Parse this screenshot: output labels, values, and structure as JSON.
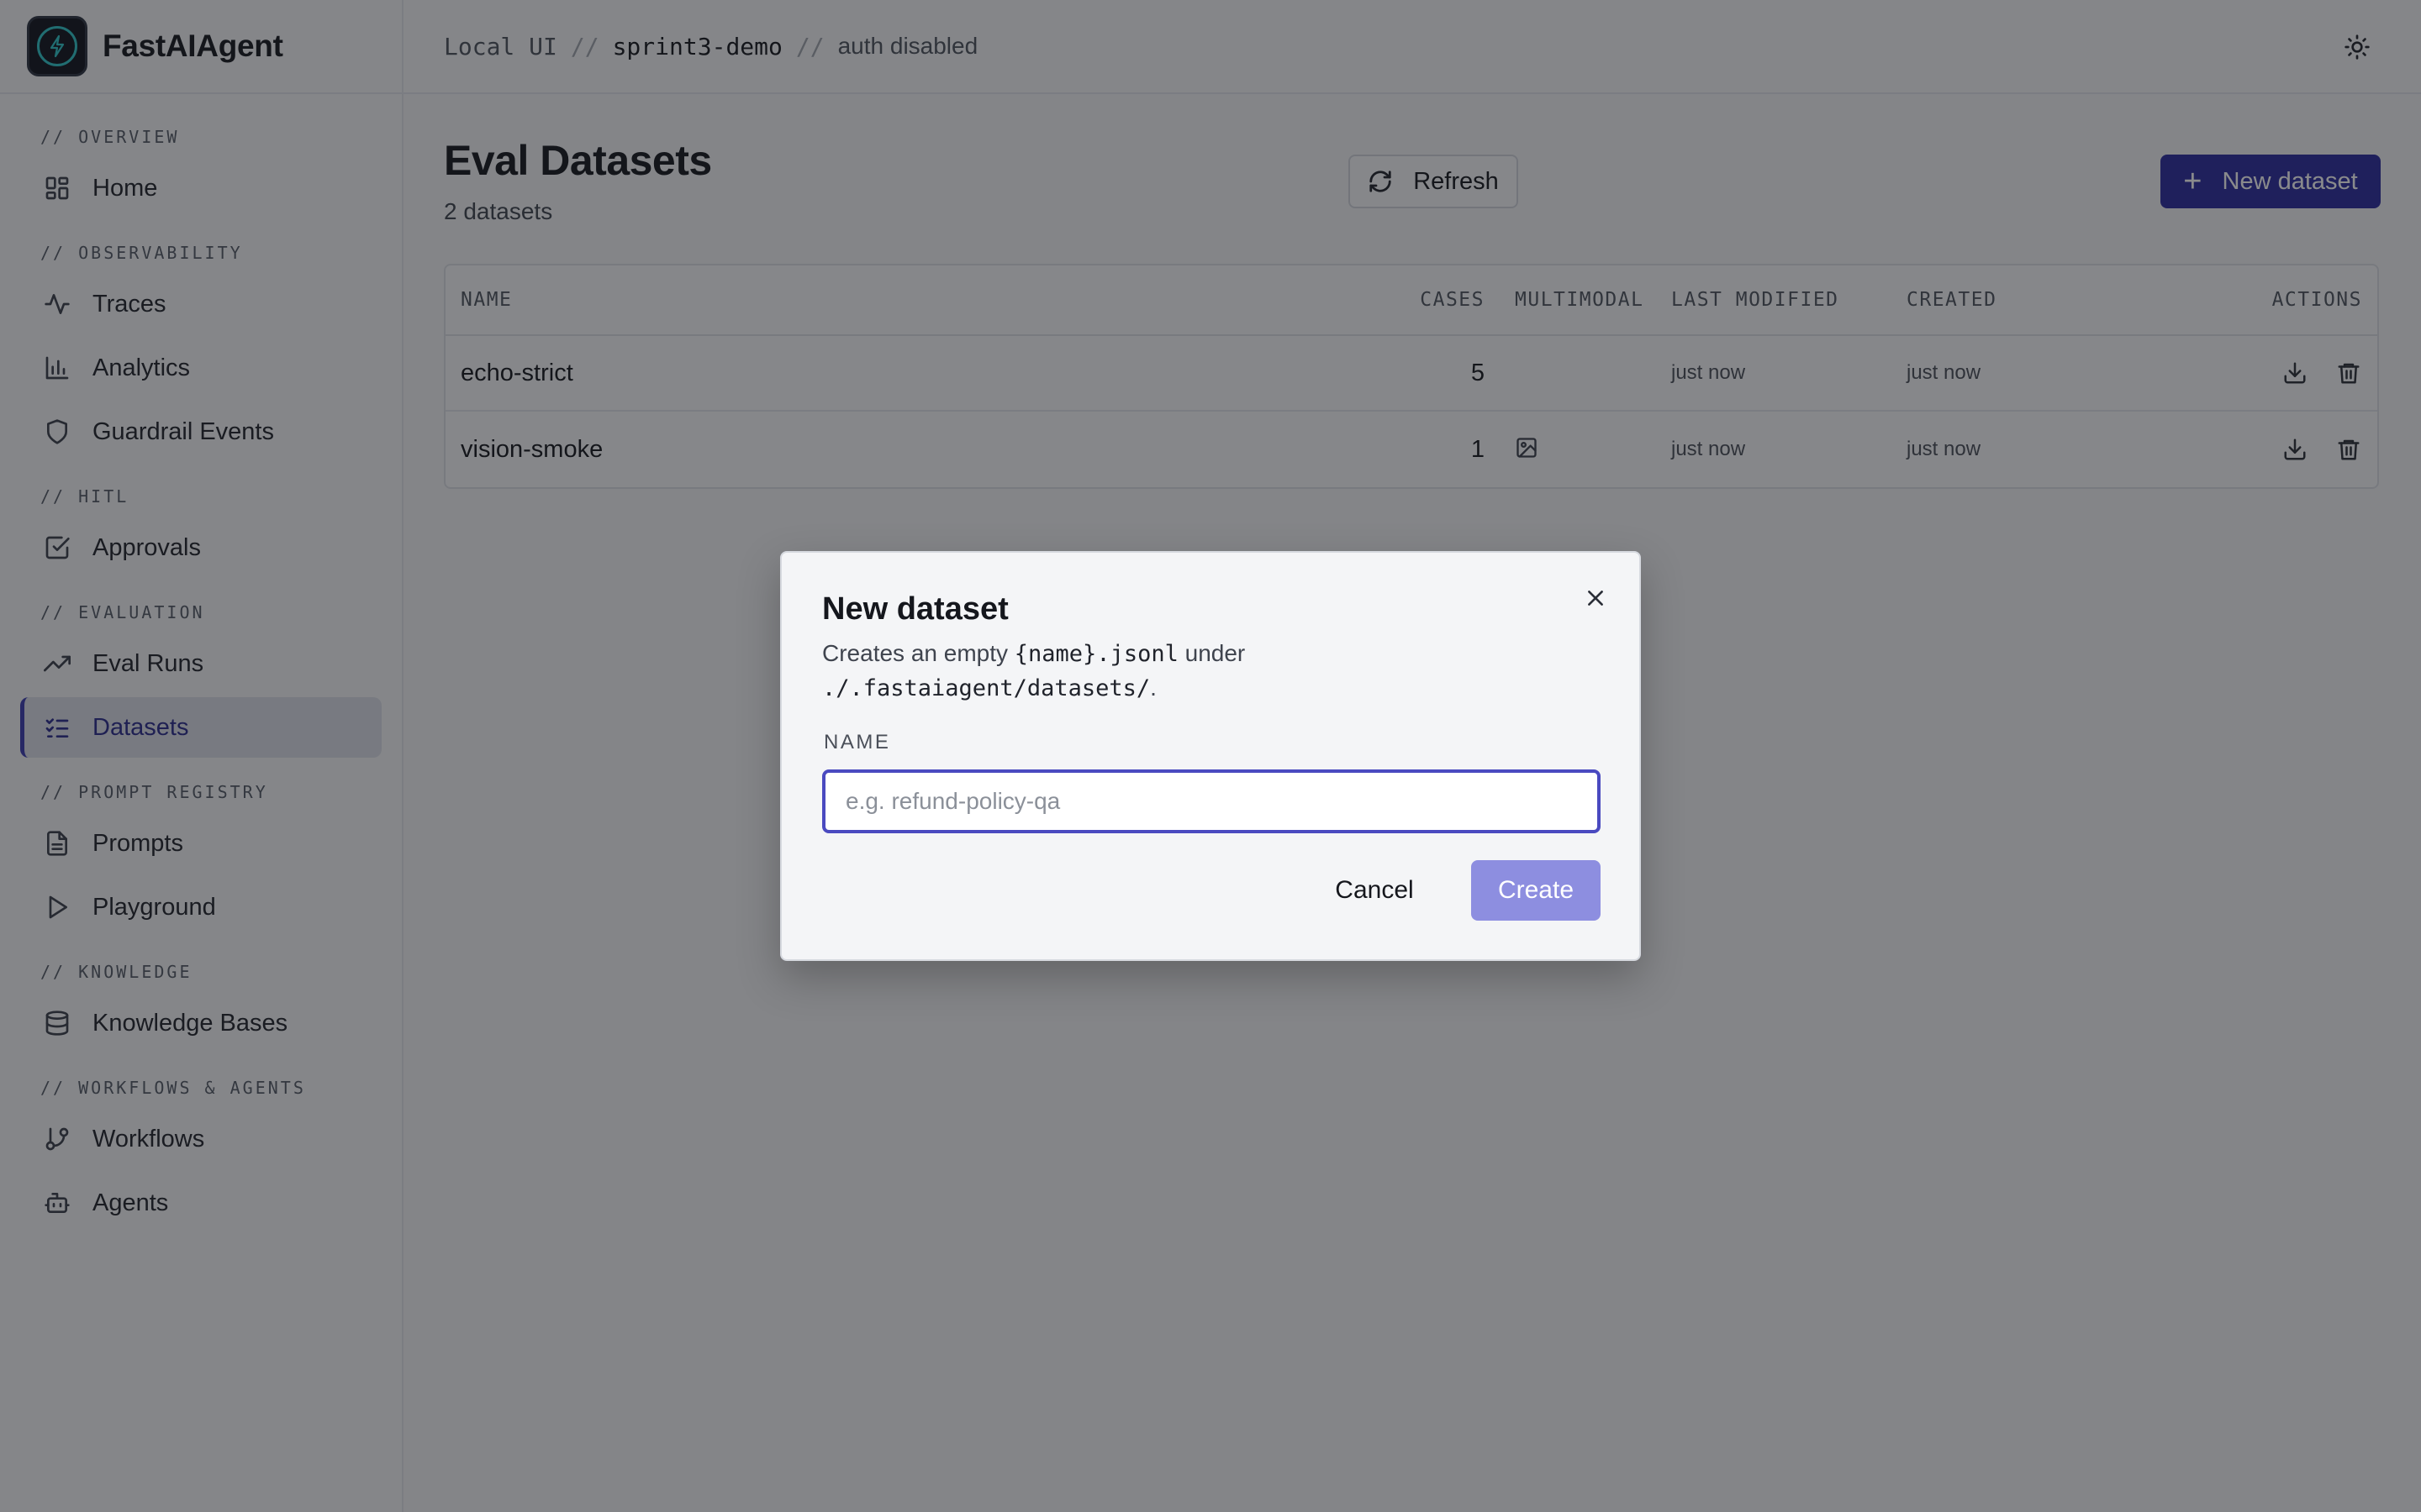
{
  "app": {
    "name": "FastAIAgent"
  },
  "breadcrumb": {
    "root": "Local UI",
    "sep": "//",
    "project": "sprint3-demo",
    "auth": "auth disabled"
  },
  "sidebar": {
    "sections": [
      {
        "title": "// OVERVIEW",
        "items": [
          {
            "label": "Home",
            "icon": "grid-icon"
          }
        ]
      },
      {
        "title": "// OBSERVABILITY",
        "items": [
          {
            "label": "Traces",
            "icon": "activity-icon"
          },
          {
            "label": "Analytics",
            "icon": "bar-chart-icon"
          },
          {
            "label": "Guardrail Events",
            "icon": "shield-icon"
          }
        ]
      },
      {
        "title": "// HITL",
        "items": [
          {
            "label": "Approvals",
            "icon": "check-square-icon"
          }
        ]
      },
      {
        "title": "// EVALUATION",
        "items": [
          {
            "label": "Eval Runs",
            "icon": "trending-up-icon"
          },
          {
            "label": "Datasets",
            "icon": "list-checks-icon",
            "active": true
          }
        ]
      },
      {
        "title": "// PROMPT REGISTRY",
        "items": [
          {
            "label": "Prompts",
            "icon": "file-text-icon"
          },
          {
            "label": "Playground",
            "icon": "play-icon"
          }
        ]
      },
      {
        "title": "// KNOWLEDGE",
        "items": [
          {
            "label": "Knowledge Bases",
            "icon": "database-icon"
          }
        ]
      },
      {
        "title": "// WORKFLOWS & AGENTS",
        "items": [
          {
            "label": "Workflows",
            "icon": "git-branch-icon"
          },
          {
            "label": "Agents",
            "icon": "bot-icon"
          }
        ]
      }
    ]
  },
  "page": {
    "title": "Eval Datasets",
    "subtitle": "2 datasets",
    "refresh_label": "Refresh",
    "new_label": "New dataset"
  },
  "table": {
    "columns": {
      "name": "NAME",
      "cases": "CASES",
      "multimodal": "MULTIMODAL",
      "modified": "LAST MODIFIED",
      "created": "CREATED",
      "actions": "ACTIONS"
    },
    "rows": [
      {
        "name": "echo-strict",
        "cases": "5",
        "multimodal": false,
        "modified": "just now",
        "created": "just now"
      },
      {
        "name": "vision-smoke",
        "cases": "1",
        "multimodal": true,
        "modified": "just now",
        "created": "just now"
      }
    ]
  },
  "dialog": {
    "title": "New dataset",
    "desc_pre": "Creates an empty ",
    "desc_code1": "{name}.jsonl",
    "desc_mid": " under",
    "desc_code2": "./.fastaiagent/datasets/",
    "desc_post": ".",
    "field_label": "NAME",
    "input_value": "",
    "input_placeholder": "e.g. refund-policy-qa",
    "cancel_label": "Cancel",
    "create_label": "Create"
  },
  "colors": {
    "accent": "#2b2b9e",
    "accent_disabled": "#8d8ee0",
    "focus_ring": "#4a4ac0"
  }
}
